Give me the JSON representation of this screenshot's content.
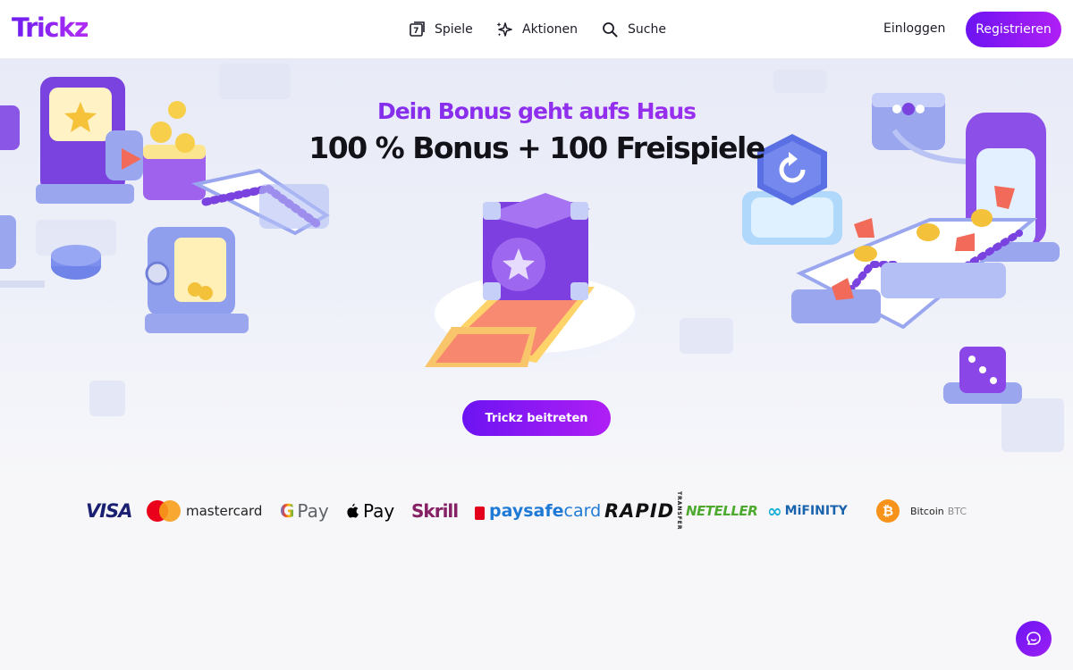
{
  "header": {
    "logo": "Trickz",
    "nav": [
      {
        "label": "Spiele",
        "icon": "game-card-icon"
      },
      {
        "label": "Aktionen",
        "icon": "sparkles-icon"
      },
      {
        "label": "Suche",
        "icon": "search-icon"
      }
    ],
    "login_label": "Einloggen",
    "register_label": "Registrieren"
  },
  "hero": {
    "subtitle": "Dein Bonus geht aufs Haus",
    "title": "100 % Bonus + 100 Freispiele",
    "cta_label": "Trickz beitreten"
  },
  "payments": {
    "visa": "VISA",
    "mastercard": "mastercard",
    "googlepay": {
      "g": "G",
      "pay": "Pay"
    },
    "applepay": "Pay",
    "skrill": "Skrill",
    "paysafecard": {
      "bold": "paysafe",
      "light": "card"
    },
    "rapid": "RAPID",
    "rapid_small": "TRANSFER",
    "neteller": "NETELLER",
    "mifinity": "MiFINITY",
    "bitcoin": {
      "symbol": "₿",
      "name": "Bitcoin",
      "ticker": "BTC"
    }
  },
  "chat": {
    "icon": "chat-bubble-icon"
  },
  "colors": {
    "brand": "#7b2ff7",
    "brand_gradient_end": "#b01ff5",
    "hero_bg": "#e8ebf7",
    "page_bg": "#f7f7f9"
  }
}
